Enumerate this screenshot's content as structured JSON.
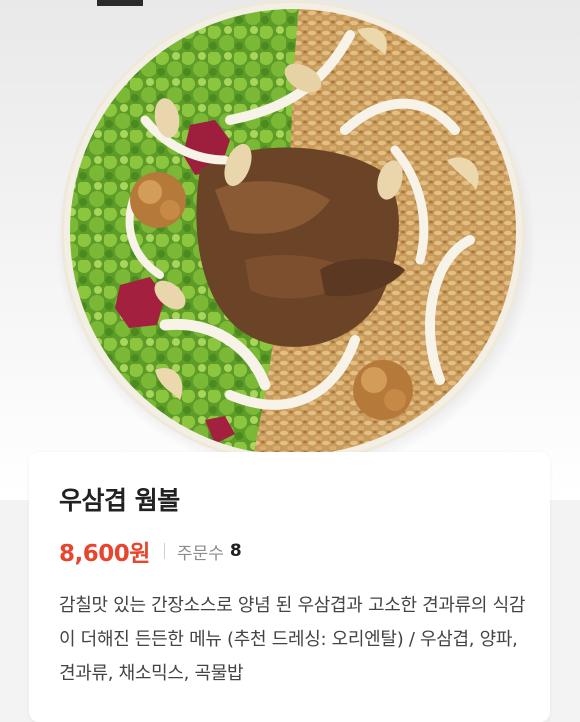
{
  "menu_item": {
    "name": "우삼겹 웜볼",
    "price": "8,600원",
    "orders_label": "주문수",
    "orders_count": "8",
    "description": "감칠맛 있는 간장소스로 양념 된 우삼겹과 고소한 견과류의 식감이 더해진 든든한 메뉴 (추천 드레싱: 오리엔탈) / 우삼겹, 양파, 견과류, 채소믹스, 곡물밥"
  },
  "colors": {
    "price": "#e8452f",
    "title": "#222222",
    "muted": "#8c8c8c",
    "card_bg": "#ffffff"
  }
}
